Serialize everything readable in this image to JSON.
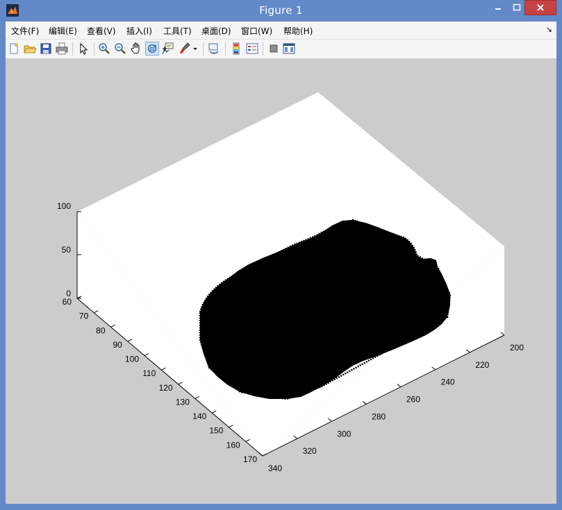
{
  "window": {
    "title": "Figure 1"
  },
  "menu": {
    "items": [
      "文件(F)",
      "编辑(E)",
      "查看(V)",
      "插入(I)",
      "工具(T)",
      "桌面(D)",
      "窗口(W)",
      "帮助(H)"
    ]
  },
  "toolbar": {
    "buttons": [
      "new-figure",
      "open-file",
      "save",
      "print",
      "edit-plot",
      "zoom-in",
      "zoom-out",
      "pan",
      "rotate-3d",
      "data-cursor",
      "brush",
      "link-plot",
      "insert-colorbar",
      "insert-legend",
      "hide-plot-tools",
      "show-plot-tools"
    ],
    "active": "rotate-3d"
  },
  "chart_data": {
    "type": "surface",
    "view": "3d",
    "x_ticks": [
      200,
      220,
      240,
      260,
      280,
      300,
      320,
      340
    ],
    "y_ticks": [
      60,
      70,
      80,
      90,
      100,
      110,
      120,
      130,
      140,
      150,
      160,
      170
    ],
    "z_ticks": [
      0,
      50,
      100
    ],
    "xlim": [
      200,
      340
    ],
    "ylim": [
      60,
      170
    ],
    "zlim": [
      0,
      100
    ],
    "colors": {
      "surface": "#000000",
      "axes_background": "#ffffff",
      "figure_background": "#cccccc"
    }
  }
}
